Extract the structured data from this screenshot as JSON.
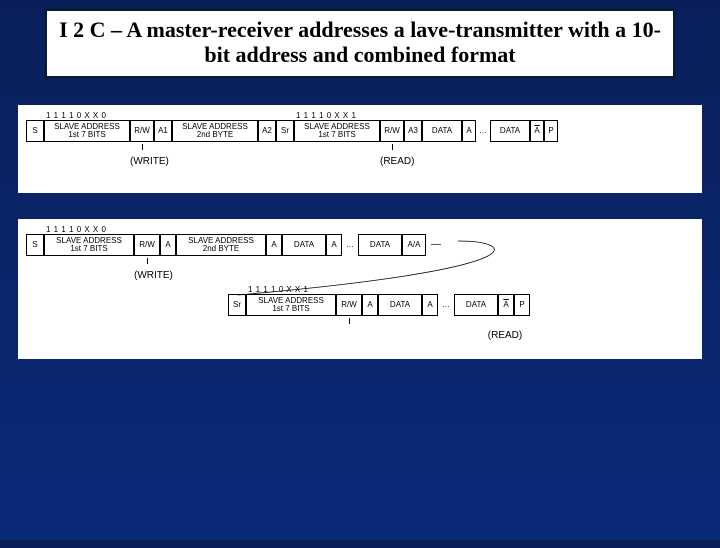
{
  "title": "I 2 C – A master-receiver addresses a lave-transmitter with a 10-bit address and combined format",
  "diagram1": {
    "bits_a": "1 1 1 1 0 X X   0",
    "bits_b": "1 1 1 1 0 X X   1",
    "s": "S",
    "addr1": "SLAVE ADDRESS\n1st 7 BITS",
    "rw": "R/W",
    "a1": "A1",
    "addr2": "SLAVE ADDRESS\n2nd BYTE",
    "a2": "A2",
    "sr": "Sr",
    "a3": "A3",
    "data": "DATA",
    "a": "A",
    "abar": "A",
    "p": "P",
    "write": "(WRITE)",
    "read": "(READ)"
  },
  "diagram2": {
    "bits_a": "1 1 1 1 0 X X   0",
    "bits_b": "1 1 1 1 0 X X   1",
    "s": "S",
    "addr1": "SLAVE ADDRESS\n1st 7 BITS",
    "rw": "R/W",
    "a": "A",
    "addr2": "SLAVE ADDRESS\n2nd BYTE",
    "data": "DATA",
    "aabar": "A/A",
    "sr": "Sr",
    "abar": "A",
    "p": "P",
    "write": "(WRITE)",
    "read": "(READ)"
  }
}
